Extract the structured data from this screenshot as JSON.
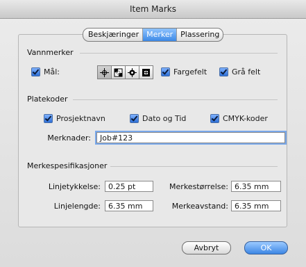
{
  "window": {
    "title": "Item Marks"
  },
  "tabs": [
    {
      "label": "Beskjæringer",
      "active": false
    },
    {
      "label": "Merker",
      "active": true
    },
    {
      "label": "Plassering",
      "active": false
    }
  ],
  "vannmerker": {
    "title": "Vannmerker",
    "maal_label": "Mål:",
    "fargefelt_label": "Fargefelt",
    "graa_label": "Grå felt"
  },
  "platekoder": {
    "title": "Platekoder",
    "prosjektnavn_label": "Prosjektnavn",
    "dato_label": "Dato og Tid",
    "cmyk_label": "CMYK-koder",
    "merknader_label": "Merknader:",
    "merknader_value": "Job#123"
  },
  "spec": {
    "title": "Merkespesifikasjoner",
    "linjetykkelse_label": "Linjetykkelse:",
    "linjetykkelse_value": "0.25 pt",
    "linjelengde_label": "Linjelengde:",
    "linjelengde_value": "6.35 mm",
    "merkestorrelse_label": "Merkestørrelse:",
    "merkestorrelse_value": "6.35 mm",
    "merkeavstand_label": "Merkeavstand:",
    "merkeavstand_value": "6.35 mm"
  },
  "buttons": {
    "cancel": "Avbryt",
    "ok": "OK"
  },
  "colors": {
    "accent": "#3d89e6",
    "checkbox": "#2d6fd6"
  }
}
